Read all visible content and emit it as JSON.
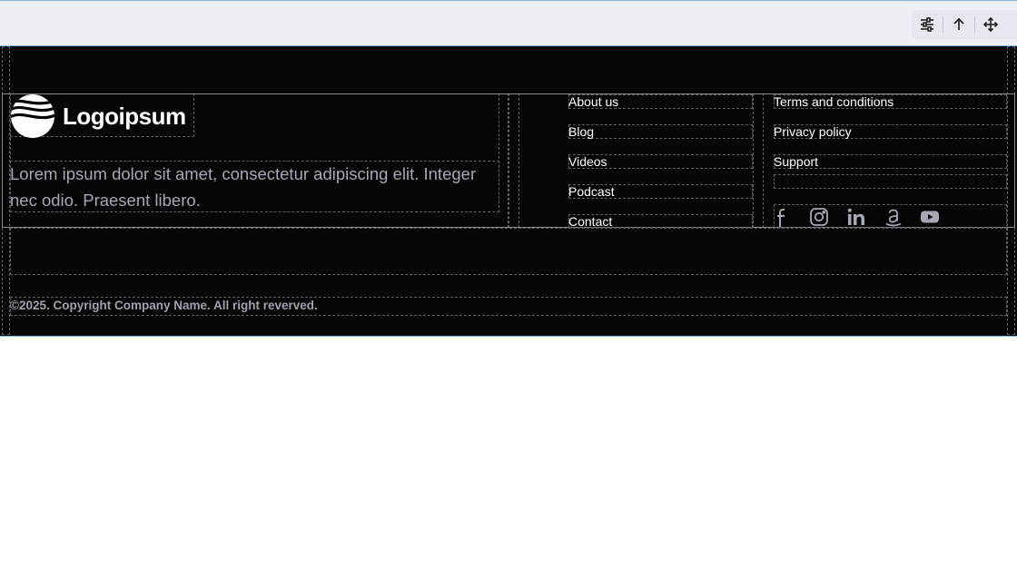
{
  "toolbar": {
    "buttons": [
      {
        "name": "settings-button",
        "icon": "sliders-icon"
      },
      {
        "name": "select-parent-button",
        "icon": "arrow-up-icon"
      },
      {
        "name": "move-button",
        "icon": "move-icon"
      }
    ]
  },
  "footer": {
    "logo_text": "Logoipsum",
    "description": "Lorem ipsum dolor sit amet, consectetur adipiscing elit. Integer nec odio. Praesent libero.",
    "nav_links": [
      "About us",
      "Blog",
      "Videos",
      "Podcast",
      "Contact"
    ],
    "legal_links": [
      "Terms and conditions",
      "Privacy policy",
      "Support"
    ],
    "social_icons": [
      "facebook-icon",
      "instagram-icon",
      "linkedin-icon",
      "amazon-icon",
      "youtube-icon"
    ],
    "copyright": "©2025. Copyright Company Name. All right reverved."
  },
  "colors": {
    "background": "#050507",
    "text": "#ffffff",
    "muted_text": "#a6a8b3",
    "toolbar_bg": "#eef0f6",
    "selection_outline": "#7fb2e0"
  }
}
